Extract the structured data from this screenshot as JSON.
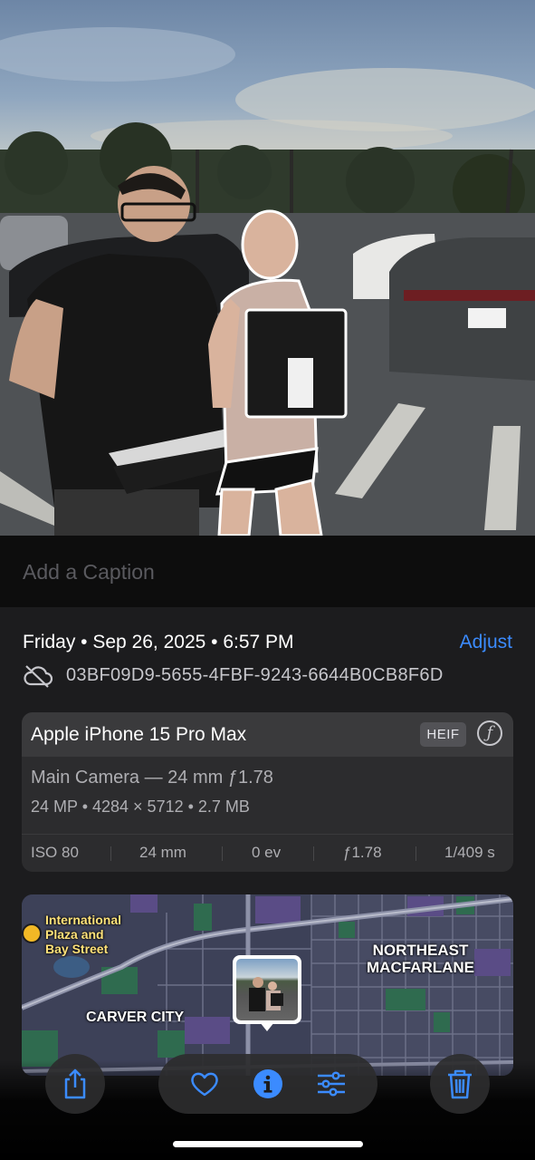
{
  "caption": {
    "placeholder": "Add a Caption"
  },
  "info": {
    "date_time": "Friday • Sep 26, 2025 • 6:57 PM",
    "adjust_label": "Adjust",
    "file_id": "03BF09D9-5655-4FBF-9243-6644B0CB8F6D",
    "cloud_icon": "cloud-slash-icon"
  },
  "camera": {
    "device": "Apple iPhone 15 Pro Max",
    "format_badge": "HEIF",
    "format_icon_glyph": "ƒ",
    "lens": "Main Camera — 24 mm ƒ1.78",
    "specs": "24 MP • 4284 × 5712 • 2.7 MB",
    "exif": [
      "ISO 80",
      "24 mm",
      "0 ev",
      "ƒ1.78",
      "1/409 s"
    ]
  },
  "map": {
    "poi": "International\nPlaza and\nBay Street",
    "poi_lines": [
      "International",
      "Plaza and",
      "Bay Street"
    ],
    "area1_lines": [
      "NORTHEAST",
      "MACFARLANE"
    ],
    "area2": "CARVER CITY"
  },
  "toolbar": {
    "share_icon": "share-icon",
    "favorite_icon": "heart-icon",
    "info_icon": "info-icon",
    "edit_icon": "sliders-icon",
    "delete_icon": "trash-icon",
    "accent_color": "#3b8bff"
  }
}
